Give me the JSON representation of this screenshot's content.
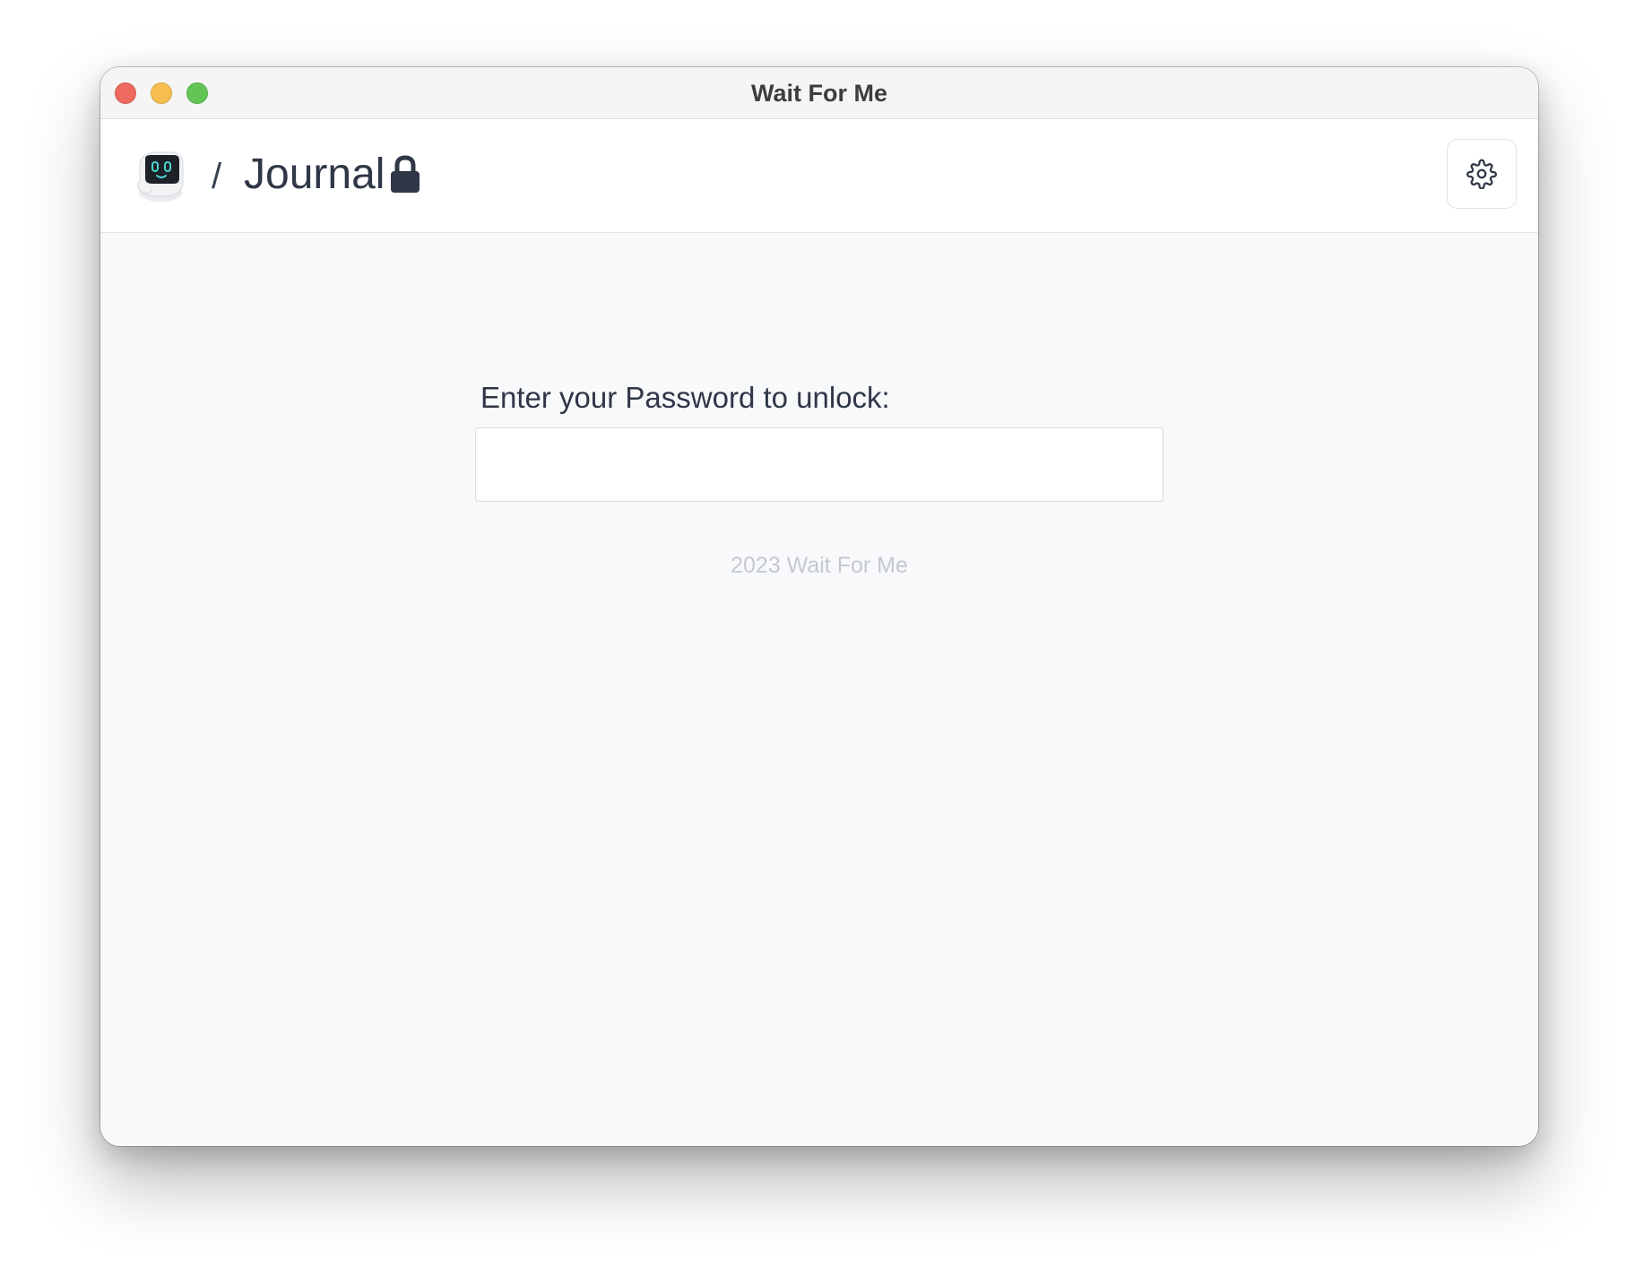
{
  "window": {
    "title": "Wait For Me"
  },
  "header": {
    "separator": "/",
    "title": "Journal",
    "logo_icon": "robot-avatar-icon",
    "lock_icon": "lock-icon",
    "settings_icon": "gear-icon"
  },
  "unlock": {
    "label": "Enter your Password to unlock:",
    "password_value": "",
    "placeholder": ""
  },
  "footer": {
    "text": "2023 Wait For Me"
  },
  "colors": {
    "close": "#ee6a5f",
    "minimize": "#f5be4f",
    "maximize": "#62c554",
    "text_dark": "#2f3747",
    "footer_text": "#c5c9cf",
    "background": "#f8f9fb"
  }
}
